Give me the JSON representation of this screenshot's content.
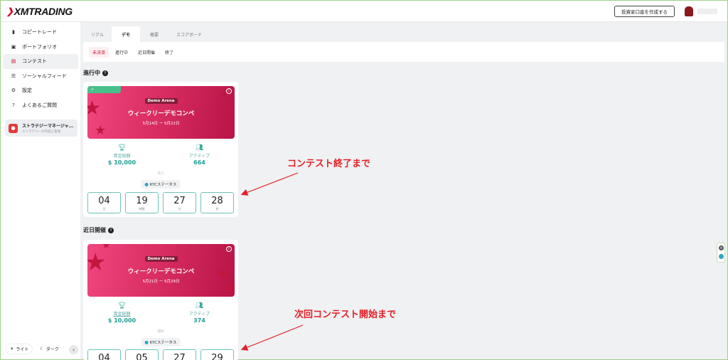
{
  "header": {
    "logo": "XMTRADING",
    "create_account": "投資家口座を作成する"
  },
  "sidebar": {
    "items": [
      {
        "label": "コピートレード",
        "icon": "bar-chart-icon"
      },
      {
        "label": "ポートフォリオ",
        "icon": "portfolio-icon"
      },
      {
        "label": "コンテスト",
        "icon": "contest-icon"
      },
      {
        "label": "ソーシャルフィード",
        "icon": "feed-icon"
      },
      {
        "label": "設定",
        "icon": "gear-icon"
      },
      {
        "label": "よくあるご質問",
        "icon": "faq-icon"
      }
    ],
    "strategy_title": "ストラテジーマネージャ...",
    "strategy_sub": "ストラテジーの作成と管理",
    "theme_light": "ライト",
    "theme_dark": "ダーク"
  },
  "tabs": [
    "リアル",
    "デモ",
    "概要",
    "スコアボード"
  ],
  "filters": [
    "未決済",
    "進行中",
    "近日開催",
    "終了"
  ],
  "sections": {
    "ongoing": "進行中",
    "upcoming": "近日開催"
  },
  "cards": [
    {
      "arena": "Demo Arena",
      "title": "ウィークリーデモコンペ",
      "dates": "5月14日 ー 5月22日",
      "prize_label": "賞金総額",
      "prize": "$ 10,000",
      "active_label": "アクティブ",
      "active": "664",
      "remaining_label": "残り",
      "kyc": "KYCステータス",
      "timers": [
        {
          "v": "04",
          "u": "日"
        },
        {
          "v": "19",
          "u": "時間"
        },
        {
          "v": "27",
          "u": "分"
        },
        {
          "v": "28",
          "u": "秒"
        }
      ]
    },
    {
      "arena": "Demo Arena",
      "title": "ウィークリーデモコンペ",
      "dates": "5月21日 ー 5月29日",
      "prize_label": "賞金総額",
      "prize": "$ 10,000",
      "active_label": "アクティブ",
      "active": "374",
      "remaining_label": "開始",
      "kyc": "KYCステータス",
      "timers": [
        {
          "v": "04",
          "u": ""
        },
        {
          "v": "05",
          "u": ""
        },
        {
          "v": "27",
          "u": ""
        },
        {
          "v": "29",
          "u": ""
        }
      ]
    }
  ],
  "annotations": {
    "a1": "コンテスト終了まで",
    "a2": "次回コンテスト開始まで"
  },
  "colors": {
    "brand": "#d10a2e",
    "annotation": "#e41f27",
    "teal": "#1f9f95",
    "banner": "#d42a5e"
  }
}
